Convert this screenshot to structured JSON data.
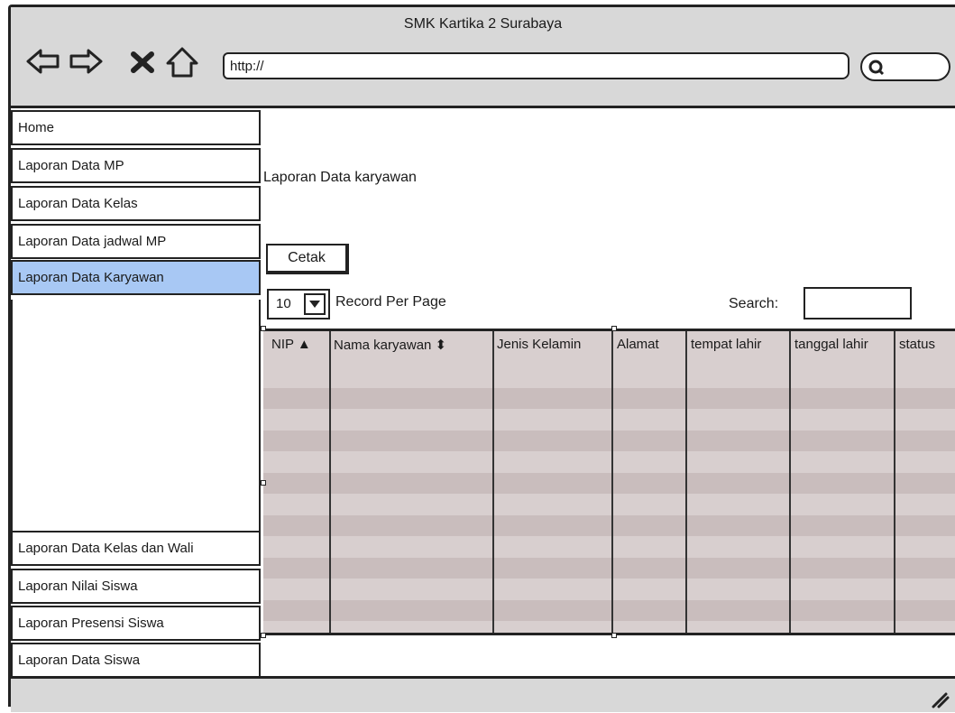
{
  "browser": {
    "title": "SMK Kartika 2 Surabaya",
    "url": "http://"
  },
  "sidebar": {
    "items": [
      {
        "label": "Home"
      },
      {
        "label": "Laporan Data MP"
      },
      {
        "label": "Laporan Data Kelas"
      },
      {
        "label": "Laporan Data jadwal MP"
      },
      {
        "label": "Laporan Data Karyawan",
        "active": true
      },
      {
        "label": "Laporan Data Kelas dan Wali"
      },
      {
        "label": "Laporan Nilai Siswa"
      },
      {
        "label": "Laporan Presensi Siswa"
      },
      {
        "label": "Laporan Data Siswa"
      }
    ]
  },
  "main": {
    "heading": "Laporan Data karyawan",
    "print_button": "Cetak",
    "per_page_value": "10",
    "per_page_label": "Record Per Page",
    "search_label": "Search:",
    "table": {
      "columns": [
        "NIP ▲",
        "Nama karyawan ⬍",
        "Jenis Kelamin",
        "Alamat",
        "tempat lahir",
        "tanggal lahir",
        "status"
      ],
      "rows": []
    }
  },
  "colors": {
    "active_item": "#a8c8f4",
    "chrome": "#d8d8d8",
    "table_bg": "#d8cfcf",
    "table_band": "#c9bdbd"
  }
}
